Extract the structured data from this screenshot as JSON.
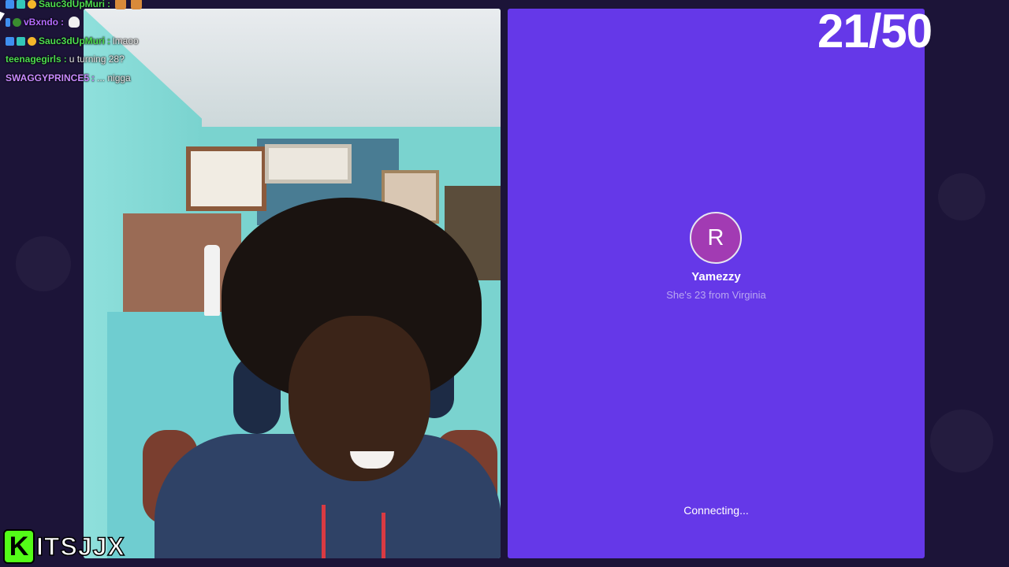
{
  "chat": [
    {
      "user": "Sauc3dUpMuri",
      "sep": ":",
      "msg": "",
      "color": "#4ddc4f",
      "badges": [
        "blue",
        "teal",
        "gold"
      ],
      "emotes": 2
    },
    {
      "user": "vBxndo",
      "sep": ":",
      "msg": "",
      "color": "#b46bff",
      "badges": [
        "blue",
        "green"
      ],
      "emotes": 1
    },
    {
      "user": "Sauc3dUpMuri",
      "sep": ":",
      "msg": "lmaoo",
      "color": "#4ddc4f",
      "badges": [
        "blue",
        "teal",
        "gold"
      ],
      "emotes": 0
    },
    {
      "user": "teenagegirls",
      "sep": ":",
      "msg": "u turning 28?",
      "color": "#4ddc4f",
      "badges": [],
      "emotes": 0
    },
    {
      "user": "SWAGGYPRINCE5",
      "sep": ":",
      "msg": "... nigga",
      "color": "#c98bff",
      "badges": [],
      "emotes": 0
    }
  ],
  "counter": "21/50",
  "peer": {
    "initial": "R",
    "name": "Yamezzy",
    "description": "She's 23 from Virginia"
  },
  "status": "Connecting...",
  "logo": {
    "letter": "K",
    "text": "ITSJJX"
  },
  "colors": {
    "background": "#1c1438",
    "panel": "#6538e8",
    "avatar": "#a23bb3",
    "kick_green": "#53fc18"
  }
}
